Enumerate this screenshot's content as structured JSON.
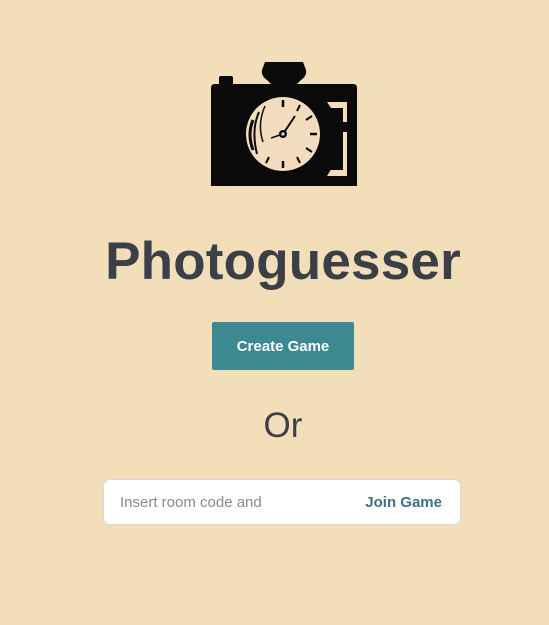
{
  "app": {
    "title": "Photoguesser",
    "logo_icon": "camera-with-clock-icon"
  },
  "actions": {
    "create_label": "Create Game",
    "or_label": "Or",
    "join_placeholder": "Insert room code and",
    "join_value": "",
    "join_label": "Join Game"
  },
  "colors": {
    "background": "#f3deba",
    "title": "#3b3f48",
    "primary_button": "#3c8991",
    "join_link": "#3a7480"
  }
}
